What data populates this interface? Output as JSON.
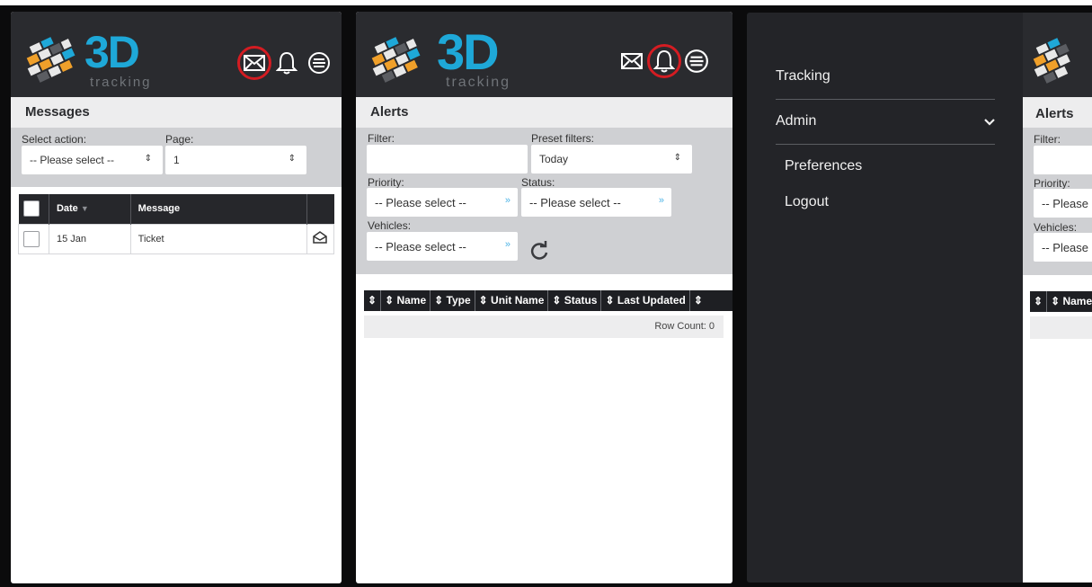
{
  "brand": {
    "name": "3D",
    "tagline": "tracking",
    "accent": "#1ea8d8",
    "header_bg": "#2a2b2f",
    "highlight_ring": "#d41c22"
  },
  "messages_panel": {
    "title": "Messages",
    "select_action_label": "Select action:",
    "select_action_value": "-- Please select --",
    "page_label": "Page:",
    "page_value": "1",
    "columns": [
      "Date",
      "Message"
    ],
    "rows": [
      {
        "date": "15 Jan",
        "message": "Ticket"
      }
    ]
  },
  "alerts_panel": {
    "title": "Alerts",
    "filter_label": "Filter:",
    "filter_value": "",
    "preset_label": "Preset filters:",
    "preset_value": "Today",
    "priority_label": "Priority:",
    "priority_value": "-- Please select --",
    "status_label": "Status:",
    "status_value": "-- Please select --",
    "vehicles_label": "Vehicles:",
    "vehicles_value": "-- Please select --",
    "columns": [
      "Name",
      "Type",
      "Unit Name",
      "Status",
      "Last Updated"
    ],
    "row_count": "Row Count: 0"
  },
  "side_menu": {
    "items": [
      "Tracking",
      "Admin",
      "Preferences",
      "Logout"
    ]
  },
  "alerts_partial": {
    "title": "Alerts",
    "filter_label": "Filter:",
    "priority_label": "Priority:",
    "priority_value": "-- Please",
    "vehicles_label": "Vehicles:",
    "vehicles_value": "-- Please",
    "name_col": "Name"
  },
  "icons": [
    "mail-icon",
    "bell-icon",
    "menu-icon",
    "refresh-icon",
    "open-envelope-icon",
    "chevron-down-icon",
    "sort-icon"
  ]
}
